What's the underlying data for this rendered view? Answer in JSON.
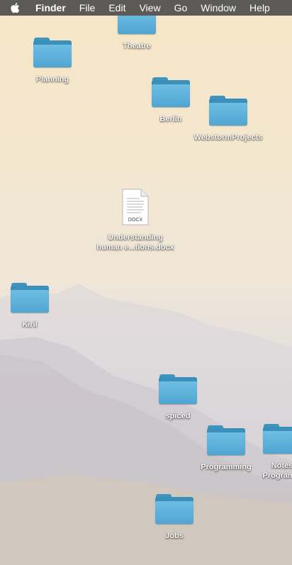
{
  "menubar": {
    "apple_icon": "apple-icon",
    "app_name": "Finder",
    "items": [
      "File",
      "Edit",
      "View",
      "Go",
      "Window",
      "Help"
    ]
  },
  "desktop": {
    "folders": {
      "theatre": "Theatre",
      "planning": "Planning",
      "berlin": "Berlin",
      "webstorm": "WebstormProjects",
      "kiril": "Kiril",
      "spiced": "spiced",
      "programming": "Programming",
      "notes_line1": "Notes",
      "notes_line2": "Programm",
      "jobs": "Jobs"
    },
    "document": {
      "badge": "DOCX",
      "line1": "Understanding",
      "line2": "human e...tions.docx"
    }
  }
}
